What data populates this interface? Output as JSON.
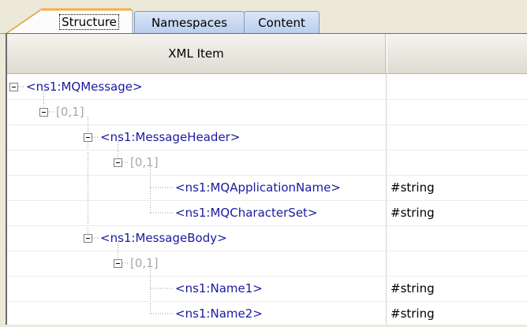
{
  "tabs": [
    {
      "label": "Structure",
      "active": true
    },
    {
      "label": "Namespaces",
      "active": false
    },
    {
      "label": "Content",
      "active": false
    }
  ],
  "grid": {
    "columns": [
      {
        "label": "XML Item"
      },
      {
        "label": ""
      }
    ],
    "rows": [
      {
        "label": "<ns1:MQMessage>",
        "kind": "element",
        "type": ""
      },
      {
        "label": "[0,1]",
        "kind": "occurrence",
        "type": ""
      },
      {
        "label": "<ns1:MessageHeader>",
        "kind": "element",
        "type": ""
      },
      {
        "label": "[0,1]",
        "kind": "occurrence",
        "type": ""
      },
      {
        "label": "<ns1:MQApplicationName>",
        "kind": "element",
        "type": "#string"
      },
      {
        "label": "<ns1:MQCharacterSet>",
        "kind": "element",
        "type": "#string"
      },
      {
        "label": "<ns1:MessageBody>",
        "kind": "element",
        "type": ""
      },
      {
        "label": "[0,1]",
        "kind": "occurrence",
        "type": ""
      },
      {
        "label": "<ns1:Name1>",
        "kind": "element",
        "type": "#string"
      },
      {
        "label": "<ns1:Name2>",
        "kind": "element",
        "type": "#string"
      }
    ]
  },
  "colors": {
    "element_text": "#1a1aa0",
    "occurrence_text": "#a8a8a8",
    "tab_accent": "#f5b13c"
  },
  "icons": {
    "expander": "collapse-minus-icon"
  }
}
